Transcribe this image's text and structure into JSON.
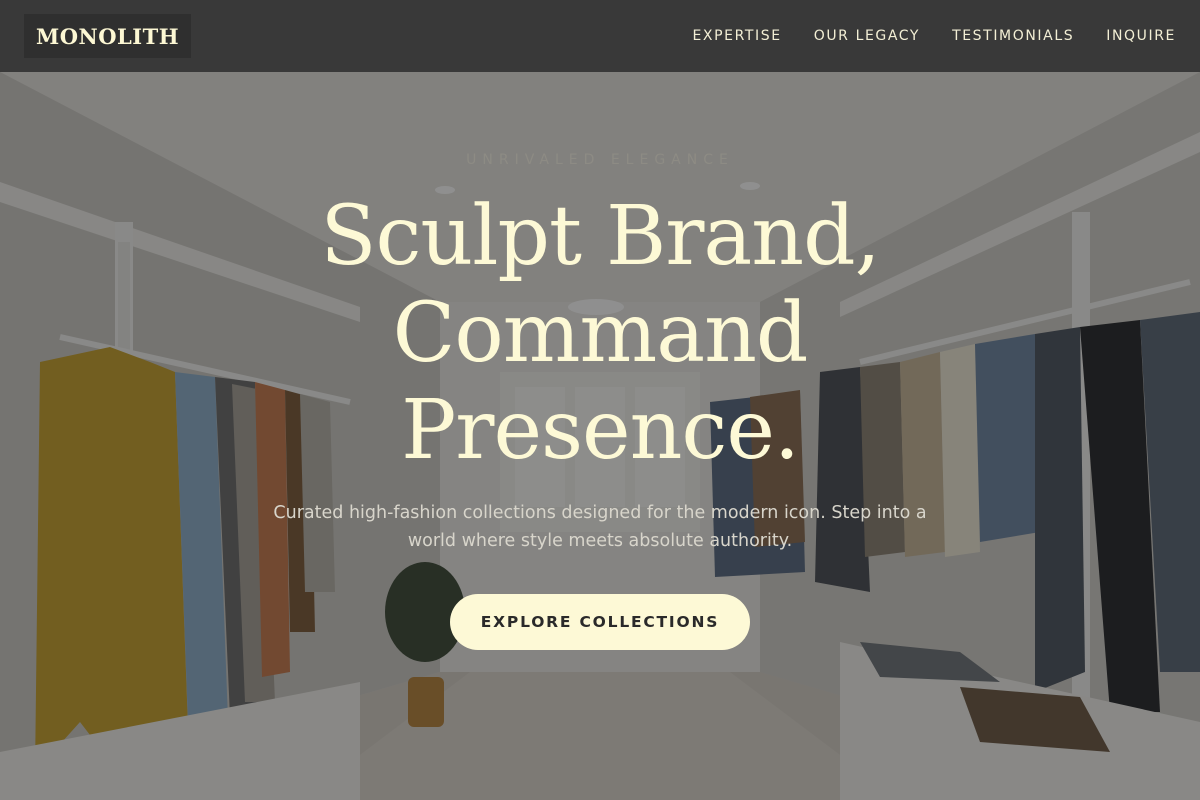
{
  "header": {
    "logo": "MONOLITH",
    "nav": [
      "EXPERTISE",
      "OUR LEGACY",
      "TESTIMONIALS",
      "INQUIRE"
    ]
  },
  "hero": {
    "eyebrow": "UNRIVALED ELEGANCE",
    "headline": [
      "Sculpt Brand,",
      "Command",
      "Presence."
    ],
    "subtitle": "Curated high-fashion collections designed for the modern icon. Step into a world where style meets absolute authority.",
    "cta_label": "EXPLORE COLLECTIONS"
  },
  "colors": {
    "accent_cream": "#fdf9d6",
    "header_bg": "#393939",
    "logo_bg": "#2f2f2f"
  }
}
